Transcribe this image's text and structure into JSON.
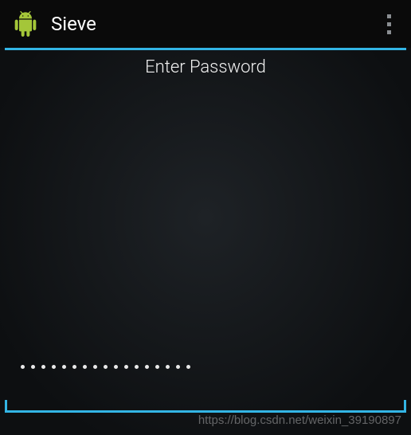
{
  "action_bar": {
    "title": "Sieve",
    "icon": "android-icon",
    "menus": {
      "overflow": "overflow-icon"
    }
  },
  "main": {
    "prompt": "Enter Password",
    "password_value": "•••••••••••••••••",
    "password_length": 17
  },
  "watermark": "https://blog.csdn.net/weixin_39190897",
  "colors": {
    "accent": "#33b5e5"
  }
}
